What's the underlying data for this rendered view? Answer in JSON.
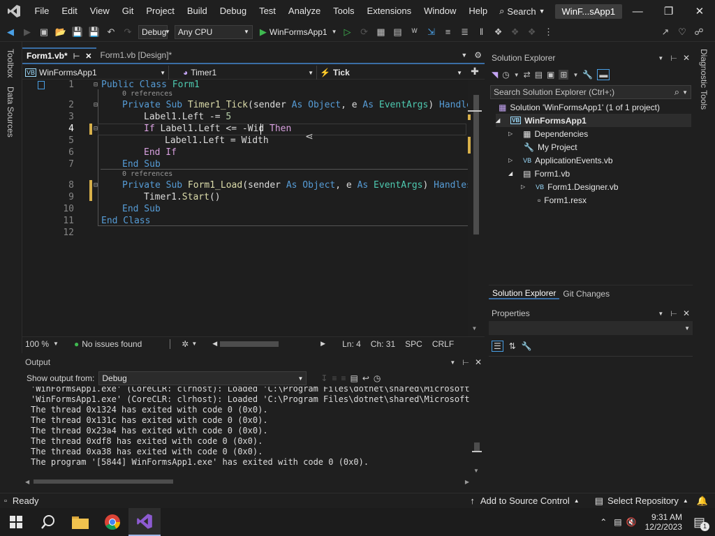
{
  "menubar": {
    "items": [
      "File",
      "Edit",
      "View",
      "Git",
      "Project",
      "Build",
      "Debug",
      "Test",
      "Analyze",
      "Tools",
      "Extensions",
      "Window",
      "Help"
    ],
    "search_label": "Search",
    "window_title": "WinF...sApp1"
  },
  "toolbar": {
    "config": "Debug",
    "platform": "Any CPU",
    "run_target": "WinFormsApp1"
  },
  "left_rail": {
    "toolbox": "Toolbox",
    "data_sources": "Data Sources"
  },
  "right_rail": {
    "diagnostic_tools": "Diagnostic Tools"
  },
  "tabs": [
    {
      "label": "Form1.vb*",
      "active": true
    },
    {
      "label": "Form1.vb [Design]*",
      "active": false
    }
  ],
  "navbar": {
    "project": "WinFormsApp1",
    "object": "Timer1",
    "event": "Tick"
  },
  "editor": {
    "line_numbers": [
      "1",
      "2",
      "3",
      "4",
      "5",
      "6",
      "7",
      "8",
      "9",
      "10",
      "11",
      "12"
    ],
    "refs_label": "0 references",
    "lines": {
      "l1a": "Public Class",
      "l1b": " Form1",
      "l2a": "Private Sub",
      "l2b": " Timer1_Tick",
      "l2c": "(sender ",
      "l2d": "As",
      "l2e": " Object",
      "l2f": ", e ",
      "l2g": "As",
      "l2h": " EventArgs",
      "l2i": ") ",
      "l2j": "Handles",
      "l3a": "Label1.Left -= ",
      "l3b": "5",
      "l4a": "If",
      "l4b": " Label1.Left <= -Wid",
      "l4c": " Then",
      "l5": "Label1.Left = Width",
      "l6": "End If",
      "l7": "End Sub",
      "l8a": "Private Sub",
      "l8b": " Form1_Load",
      "l8c": "(sender ",
      "l8d": "As",
      "l8e": " Object",
      "l8f": ", e ",
      "l8g": "As",
      "l8h": " EventArgs",
      "l8i": ") ",
      "l8j": "Handles",
      "l9a": "Timer1.",
      "l9b": "Start",
      "l9c": "()",
      "l10": "End Sub",
      "l11": "End Class"
    }
  },
  "editor_status": {
    "zoom": "100 %",
    "issues": "No issues found",
    "line": "Ln: 4",
    "col": "Ch: 31",
    "spc": "SPC",
    "eol": "CRLF"
  },
  "output": {
    "title": "Output",
    "show_from_label": "Show output from:",
    "source": "Debug",
    "lines": [
      "'WinFormsApp1.exe' (CoreCLR: clrhost): Loaded 'C:\\Program Files\\dotnet\\shared\\Microsoft.Wi",
      "'WinFormsApp1.exe' (CoreCLR: clrhost): Loaded 'C:\\Program Files\\dotnet\\shared\\Microsoft.NE",
      "The thread 0x1324 has exited with code 0 (0x0).",
      "The thread 0x131c has exited with code 0 (0x0).",
      "The thread 0x23a4 has exited with code 0 (0x0).",
      "The thread 0xdf8 has exited with code 0 (0x0).",
      "The thread 0xa38 has exited with code 0 (0x0).",
      "The program '[5844] WinFormsApp1.exe' has exited with code 0 (0x0)."
    ]
  },
  "solution_explorer": {
    "title": "Solution Explorer",
    "search_placeholder": "Search Solution Explorer (Ctrl+;)",
    "tree": [
      {
        "label": "Solution 'WinFormsApp1' (1 of 1 project)"
      },
      {
        "label": "WinFormsApp1"
      },
      {
        "label": "Dependencies"
      },
      {
        "label": "My Project"
      },
      {
        "label": "ApplicationEvents.vb"
      },
      {
        "label": "Form1.vb"
      },
      {
        "label": "Form1.Designer.vb"
      },
      {
        "label": "Form1.resx"
      }
    ],
    "tabs": [
      "Solution Explorer",
      "Git Changes"
    ]
  },
  "properties": {
    "title": "Properties"
  },
  "statusbar": {
    "ready": "Ready",
    "source_control": "Add to Source Control",
    "repository": "Select Repository"
  },
  "taskbar": {
    "time": "9:31 AM",
    "date": "12/2/2023",
    "notification_count": "1"
  },
  "colors": {
    "accent": "#3a6ea5",
    "vs_purple": "#8d5bd1",
    "keyword": "#569cd6",
    "type": "#4ec9b0",
    "method": "#dcdcaa"
  }
}
